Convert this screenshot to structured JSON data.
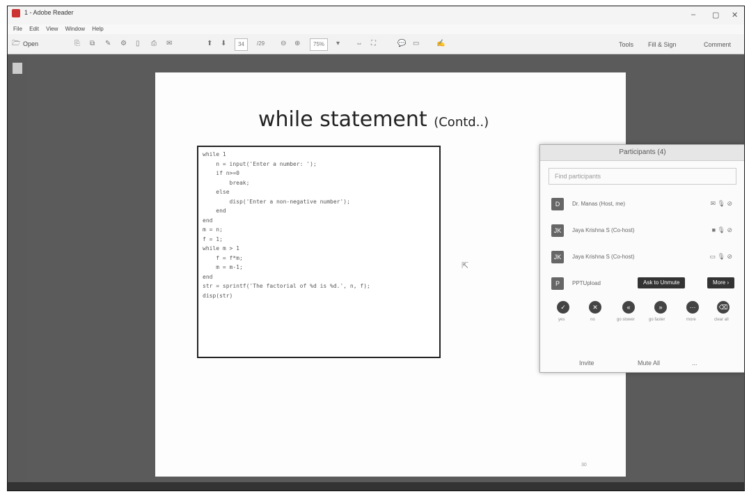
{
  "window": {
    "title": "1 - Adobe Reader",
    "min": "–",
    "restore": "▢",
    "close": "✕"
  },
  "menubar": [
    "File",
    "Edit",
    "View",
    "Window",
    "Help"
  ],
  "toolbar": {
    "open": "Open",
    "page_current": "34",
    "page_total": "/29",
    "zoom": "75%",
    "tools": "Tools",
    "fill_sign": "Fill & Sign",
    "comment": "Comment"
  },
  "slide": {
    "title": "while statement",
    "title_suffix": "(Contd..)",
    "code": [
      "while 1",
      "    n = input('Enter a number: ');",
      "    if n>=0",
      "        break;",
      "    else",
      "        disp('Enter a non-negative number');",
      "    end",
      "end",
      "",
      "m = n;",
      "f = 1;",
      "while m > 1",
      "    f = f*m;",
      "    m = m-1;",
      "end",
      "str = sprintf('The factorial of %d is %d.', n, f);",
      "disp(str)"
    ],
    "page_number": "30"
  },
  "participants": {
    "title": "Participants (4)",
    "search_placeholder": "Find participants",
    "rows": [
      {
        "initial": "D",
        "name": "Dr. Manas (Host, me)",
        "icons": "✉ 🎙 ⊘"
      },
      {
        "initial": "JK",
        "name": "Jaya Krishna S (Co-host)",
        "icons": "■ 🎙 ⊘"
      },
      {
        "initial": "JK",
        "name": "Jaya Krishna S (Co-host)",
        "icons": "▭ 🎙 ⊘"
      },
      {
        "initial": "P",
        "name": "PPTUpload",
        "icons": ""
      }
    ],
    "admit_label": "Ask to Unmute",
    "more_label": "More ›",
    "controls": [
      "yes",
      "no",
      "go slower",
      "go faster",
      "more",
      "clear all"
    ],
    "footer": {
      "invite": "Invite",
      "mute_all": "Mute All",
      "more": "..."
    }
  }
}
